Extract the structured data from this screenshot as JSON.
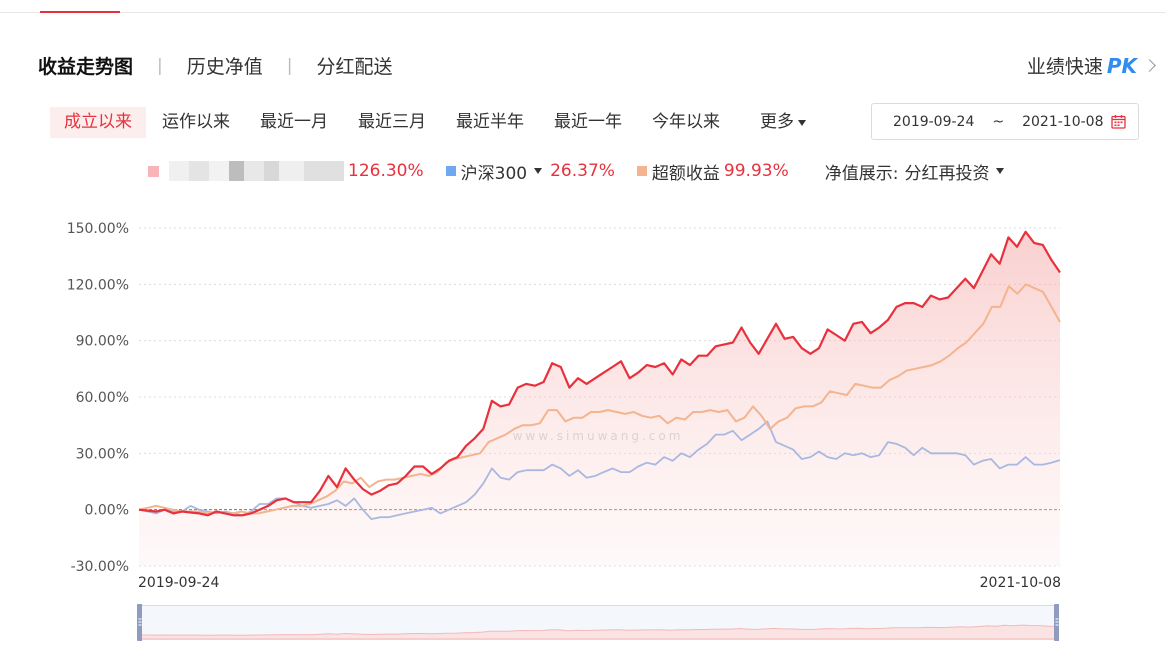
{
  "header": {
    "tabs": [
      {
        "label": "收益走势图",
        "active": true
      },
      {
        "label": "历史净值",
        "active": false
      },
      {
        "label": "分红配送",
        "active": false
      }
    ],
    "pk_label": "业绩快速",
    "pk_badge": "PK"
  },
  "range_tabs": [
    {
      "label": "成立以来",
      "active": true
    },
    {
      "label": "运作以来",
      "active": false
    },
    {
      "label": "最近一月",
      "active": false
    },
    {
      "label": "最近三月",
      "active": false
    },
    {
      "label": "最近半年",
      "active": false
    },
    {
      "label": "最近一年",
      "active": false
    },
    {
      "label": "今年以来",
      "active": false
    }
  ],
  "more_label": "更多",
  "date_range": {
    "start": "2019-09-24",
    "separator": "~",
    "end": "2021-10-08"
  },
  "legend": {
    "fund_value": "126.30%",
    "index_name": "沪深300",
    "index_value": "26.37%",
    "excess_name": "超额收益",
    "excess_value": "99.93%",
    "nav_display_label": "净值展示:",
    "nav_display_value": "分红再投资"
  },
  "colors": {
    "fund": "#e8313d",
    "index": "#a9b8e0",
    "index_swatch": "#6fa8f0",
    "excess": "#f3b48f",
    "accent": "#e8313d"
  },
  "chart_data": {
    "type": "line",
    "x_start": "2019-09-24",
    "x_end": "2021-10-08",
    "x_tick_labels": [
      "2019-09-24",
      "2021-10-08"
    ],
    "y_ticks": [
      "150.00%",
      "120.00%",
      "90.00%",
      "60.00%",
      "30.00%",
      "0.00%",
      "-30.00%"
    ],
    "ylim": [
      -30,
      150
    ],
    "y_unit": "%",
    "grid": true,
    "zero_line": true,
    "watermark": "www.simuwang.com",
    "series": [
      {
        "name": "",
        "role": "fund",
        "area": true,
        "values": [
          0,
          -0.5,
          -1,
          0,
          -2,
          -1,
          -1.5,
          -2,
          -3,
          -1,
          -2,
          -3,
          -3,
          -2,
          0,
          2,
          5,
          6,
          4,
          4,
          4,
          10,
          18,
          12,
          22,
          16,
          11,
          8,
          10,
          13,
          14,
          18,
          23,
          23,
          19,
          22,
          26,
          28,
          34,
          38,
          43,
          58,
          55,
          56,
          65,
          67,
          66,
          68,
          78,
          76,
          65,
          70,
          67,
          70,
          73,
          76,
          79,
          70,
          73,
          77,
          76,
          78,
          72,
          80,
          77,
          82,
          82,
          87,
          88,
          89,
          97,
          89,
          83,
          91,
          99,
          91,
          92,
          86,
          83,
          86,
          96,
          93,
          90,
          99,
          100,
          94,
          97,
          101,
          108,
          110,
          110,
          108,
          114,
          112,
          113,
          118,
          123,
          118,
          127,
          136,
          131,
          145,
          140,
          148,
          142,
          141,
          133,
          126.3
        ]
      },
      {
        "name": "沪深300",
        "role": "index",
        "area": false,
        "values": [
          0,
          -1,
          -2,
          0,
          -1,
          -1,
          2,
          0,
          -1,
          -2,
          -1,
          -2,
          -3,
          -1,
          3,
          3,
          6,
          6,
          4,
          2,
          1,
          2,
          3,
          5,
          2,
          6,
          0,
          -5,
          -4,
          -4,
          -3,
          -2,
          -1,
          0,
          1,
          -2,
          0,
          2,
          4,
          8,
          14,
          22,
          17,
          16,
          20,
          21,
          21,
          21,
          24,
          22,
          18,
          21,
          17,
          18,
          20,
          22,
          20,
          20,
          23,
          25,
          24,
          28,
          26,
          30,
          28,
          32,
          35,
          40,
          40,
          42,
          37,
          40,
          43,
          47,
          36,
          34,
          32,
          27,
          28,
          31,
          28,
          27,
          30,
          29,
          30,
          28,
          29,
          36,
          35,
          33,
          29,
          33,
          30,
          30,
          30,
          30,
          29,
          24,
          26,
          27,
          22,
          24,
          24,
          28,
          24,
          24,
          25,
          26.37
        ]
      },
      {
        "name": "超额收益",
        "role": "excess",
        "area": false,
        "values": [
          0,
          1,
          2,
          1,
          0,
          -1,
          -1,
          -1,
          -2,
          -1,
          -2,
          -2,
          -1,
          -2,
          -2,
          -1,
          0,
          1,
          2,
          2,
          3,
          5,
          7,
          10,
          15,
          14,
          17,
          12,
          15,
          16,
          16,
          17,
          18,
          19,
          18,
          20,
          25,
          27,
          28,
          29,
          30,
          36,
          38,
          40,
          43,
          45,
          45,
          46,
          53,
          53,
          47,
          49,
          49,
          52,
          52,
          53,
          52,
          51,
          52,
          50,
          49,
          50,
          46,
          49,
          48,
          52,
          52,
          53,
          52,
          53,
          47,
          49,
          55,
          50,
          43,
          47,
          49,
          54,
          55,
          55,
          57,
          63,
          62,
          61,
          67,
          66,
          65,
          65,
          69,
          71,
          74,
          75,
          76,
          77,
          79,
          82,
          86,
          89,
          94,
          99,
          108,
          108,
          119,
          115,
          120,
          118,
          116,
          108,
          99.93
        ]
      }
    ]
  }
}
